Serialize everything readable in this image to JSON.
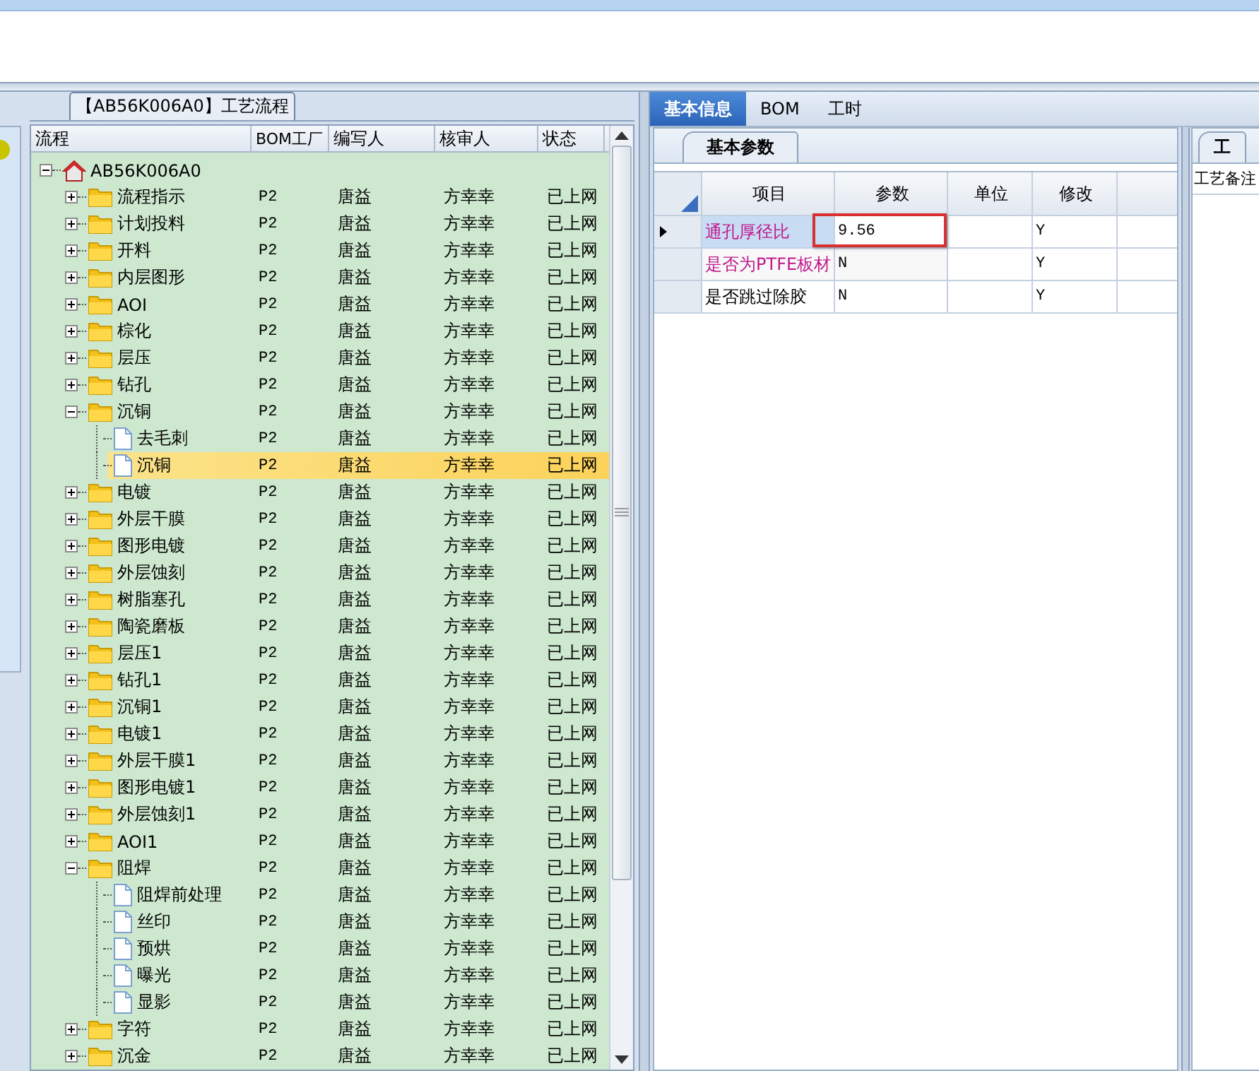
{
  "tree_panel": {
    "title": "【AB56K006A0】工艺流程",
    "columns": [
      "流程",
      "BOM工厂",
      "编写人",
      "核审人",
      "状态"
    ],
    "root": {
      "label": "AB56K006A0",
      "kind": "root",
      "expanded": true,
      "selected": false,
      "children": [
        {
          "label": "流程指示",
          "kind": "folder",
          "expanded": false,
          "selected": false,
          "bom": "P2",
          "author": "唐益",
          "reviewer": "方幸幸",
          "status": "已上网"
        },
        {
          "label": "计划投料",
          "kind": "folder",
          "expanded": false,
          "selected": false,
          "bom": "P2",
          "author": "唐益",
          "reviewer": "方幸幸",
          "status": "已上网"
        },
        {
          "label": "开料",
          "kind": "folder",
          "expanded": false,
          "selected": false,
          "bom": "P2",
          "author": "唐益",
          "reviewer": "方幸幸",
          "status": "已上网"
        },
        {
          "label": "内层图形",
          "kind": "folder",
          "expanded": false,
          "selected": false,
          "bom": "P2",
          "author": "唐益",
          "reviewer": "方幸幸",
          "status": "已上网"
        },
        {
          "label": "AOI",
          "kind": "folder",
          "expanded": false,
          "selected": false,
          "bom": "P2",
          "author": "唐益",
          "reviewer": "方幸幸",
          "status": "已上网"
        },
        {
          "label": "棕化",
          "kind": "folder",
          "expanded": false,
          "selected": false,
          "bom": "P2",
          "author": "唐益",
          "reviewer": "方幸幸",
          "status": "已上网"
        },
        {
          "label": "层压",
          "kind": "folder",
          "expanded": false,
          "selected": false,
          "bom": "P2",
          "author": "唐益",
          "reviewer": "方幸幸",
          "status": "已上网"
        },
        {
          "label": "钻孔",
          "kind": "folder",
          "expanded": false,
          "selected": false,
          "bom": "P2",
          "author": "唐益",
          "reviewer": "方幸幸",
          "status": "已上网"
        },
        {
          "label": "沉铜",
          "kind": "folder",
          "expanded": true,
          "selected": false,
          "bom": "P2",
          "author": "唐益",
          "reviewer": "方幸幸",
          "status": "已上网",
          "children": [
            {
              "label": "去毛刺",
              "kind": "file",
              "selected": false,
              "bom": "P2",
              "author": "唐益",
              "reviewer": "方幸幸",
              "status": "已上网"
            },
            {
              "label": "沉铜",
              "kind": "file",
              "selected": true,
              "bom": "P2",
              "author": "唐益",
              "reviewer": "方幸幸",
              "status": "已上网"
            }
          ]
        },
        {
          "label": "电镀",
          "kind": "folder",
          "expanded": false,
          "selected": false,
          "bom": "P2",
          "author": "唐益",
          "reviewer": "方幸幸",
          "status": "已上网"
        },
        {
          "label": "外层干膜",
          "kind": "folder",
          "expanded": false,
          "selected": false,
          "bom": "P2",
          "author": "唐益",
          "reviewer": "方幸幸",
          "status": "已上网"
        },
        {
          "label": "图形电镀",
          "kind": "folder",
          "expanded": false,
          "selected": false,
          "bom": "P2",
          "author": "唐益",
          "reviewer": "方幸幸",
          "status": "已上网"
        },
        {
          "label": "外层蚀刻",
          "kind": "folder",
          "expanded": false,
          "selected": false,
          "bom": "P2",
          "author": "唐益",
          "reviewer": "方幸幸",
          "status": "已上网"
        },
        {
          "label": "树脂塞孔",
          "kind": "folder",
          "expanded": false,
          "selected": false,
          "bom": "P2",
          "author": "唐益",
          "reviewer": "方幸幸",
          "status": "已上网"
        },
        {
          "label": "陶瓷磨板",
          "kind": "folder",
          "expanded": false,
          "selected": false,
          "bom": "P2",
          "author": "唐益",
          "reviewer": "方幸幸",
          "status": "已上网"
        },
        {
          "label": "层压1",
          "kind": "folder",
          "expanded": false,
          "selected": false,
          "bom": "P2",
          "author": "唐益",
          "reviewer": "方幸幸",
          "status": "已上网"
        },
        {
          "label": "钻孔1",
          "kind": "folder",
          "expanded": false,
          "selected": false,
          "bom": "P2",
          "author": "唐益",
          "reviewer": "方幸幸",
          "status": "已上网"
        },
        {
          "label": "沉铜1",
          "kind": "folder",
          "expanded": false,
          "selected": false,
          "bom": "P2",
          "author": "唐益",
          "reviewer": "方幸幸",
          "status": "已上网"
        },
        {
          "label": "电镀1",
          "kind": "folder",
          "expanded": false,
          "selected": false,
          "bom": "P2",
          "author": "唐益",
          "reviewer": "方幸幸",
          "status": "已上网"
        },
        {
          "label": "外层干膜1",
          "kind": "folder",
          "expanded": false,
          "selected": false,
          "bom": "P2",
          "author": "唐益",
          "reviewer": "方幸幸",
          "status": "已上网"
        },
        {
          "label": "图形电镀1",
          "kind": "folder",
          "expanded": false,
          "selected": false,
          "bom": "P2",
          "author": "唐益",
          "reviewer": "方幸幸",
          "status": "已上网"
        },
        {
          "label": "外层蚀刻1",
          "kind": "folder",
          "expanded": false,
          "selected": false,
          "bom": "P2",
          "author": "唐益",
          "reviewer": "方幸幸",
          "status": "已上网"
        },
        {
          "label": "AOI1",
          "kind": "folder",
          "expanded": false,
          "selected": false,
          "bom": "P2",
          "author": "唐益",
          "reviewer": "方幸幸",
          "status": "已上网"
        },
        {
          "label": "阻焊",
          "kind": "folder",
          "expanded": true,
          "selected": false,
          "bom": "P2",
          "author": "唐益",
          "reviewer": "方幸幸",
          "status": "已上网",
          "children": [
            {
              "label": "阻焊前处理",
              "kind": "file",
              "selected": false,
              "bom": "P2",
              "author": "唐益",
              "reviewer": "方幸幸",
              "status": "已上网"
            },
            {
              "label": "丝印",
              "kind": "file",
              "selected": false,
              "bom": "P2",
              "author": "唐益",
              "reviewer": "方幸幸",
              "status": "已上网"
            },
            {
              "label": "预烘",
              "kind": "file",
              "selected": false,
              "bom": "P2",
              "author": "唐益",
              "reviewer": "方幸幸",
              "status": "已上网"
            },
            {
              "label": "曝光",
              "kind": "file",
              "selected": false,
              "bom": "P2",
              "author": "唐益",
              "reviewer": "方幸幸",
              "status": "已上网"
            },
            {
              "label": "显影",
              "kind": "file",
              "selected": false,
              "bom": "P2",
              "author": "唐益",
              "reviewer": "方幸幸",
              "status": "已上网"
            }
          ]
        },
        {
          "label": "字符",
          "kind": "folder",
          "expanded": false,
          "selected": false,
          "bom": "P2",
          "author": "唐益",
          "reviewer": "方幸幸",
          "status": "已上网"
        },
        {
          "label": "沉金",
          "kind": "folder",
          "expanded": false,
          "selected": false,
          "bom": "P2",
          "author": "唐益",
          "reviewer": "方幸幸",
          "status": "已上网"
        }
      ]
    }
  },
  "tabs": [
    {
      "label": "基本信息",
      "selected": true
    },
    {
      "label": "BOM",
      "selected": false
    },
    {
      "label": "工时",
      "selected": false
    }
  ],
  "params_panel": {
    "tab": "基本参数",
    "columns": [
      "项目",
      "参数",
      "单位",
      "修改"
    ],
    "rows": [
      {
        "item": "通孔厚径比",
        "value": "9.56",
        "modify": "Y",
        "color": "#c0198c",
        "selected": true
      },
      {
        "item": "是否为PTFE板材",
        "value": "N",
        "modify": "Y",
        "color": "#c0198c",
        "selected": false
      },
      {
        "item": "是否跳过除胶",
        "value": "N",
        "modify": "Y",
        "color": "#000000",
        "selected": false
      }
    ]
  },
  "notes_panel": {
    "tab": "工",
    "label": "工艺备注"
  }
}
